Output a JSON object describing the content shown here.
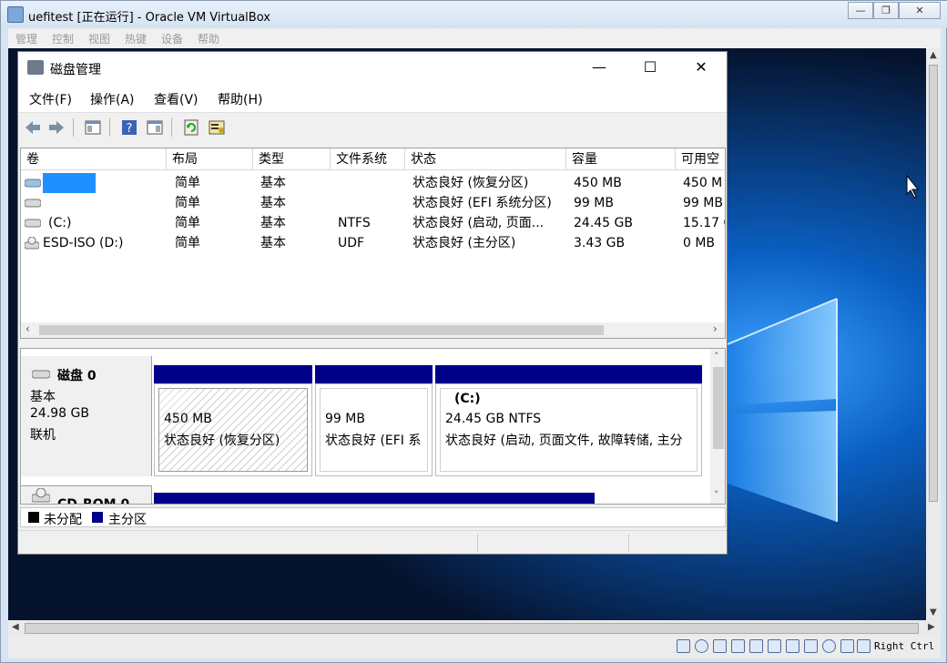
{
  "vbox": {
    "title": "uefitest [正在运行] - Oracle VM VirtualBox",
    "menu": [
      "管理",
      "控制",
      "视图",
      "热键",
      "设备",
      "帮助"
    ],
    "status_key": "Right Ctrl"
  },
  "dm": {
    "title": "磁盘管理",
    "window_buttons": {
      "minimize": "—",
      "maximize": "☐",
      "close": "✕"
    },
    "menu": [
      "文件(F)",
      "操作(A)",
      "查看(V)",
      "帮助(H)"
    ],
    "columns": [
      "卷",
      "布局",
      "类型",
      "文件系统",
      "状态",
      "容量",
      "可用空"
    ],
    "volumes": [
      {
        "name": "",
        "layout": "简单",
        "type": "基本",
        "fs": "",
        "status": "状态良好 (恢复分区)",
        "capacity": "450 MB",
        "free": "450 M"
      },
      {
        "name": "",
        "layout": "简单",
        "type": "基本",
        "fs": "",
        "status": "状态良好 (EFI 系统分区)",
        "capacity": "99 MB",
        "free": "99 MB"
      },
      {
        "name": "(C:)",
        "layout": "简单",
        "type": "基本",
        "fs": "NTFS",
        "status": "状态良好 (启动, 页面...",
        "capacity": "24.45 GB",
        "free": "15.17 G"
      },
      {
        "name": "ESD-ISO (D:)",
        "layout": "简单",
        "type": "基本",
        "fs": "UDF",
        "status": "状态良好 (主分区)",
        "capacity": "3.43 GB",
        "free": "0 MB"
      }
    ],
    "disk0": {
      "name": "磁盘 0",
      "kind": "基本",
      "size": "24.98 GB",
      "state": "联机",
      "partitions": [
        {
          "label": "",
          "size": "450 MB",
          "status": "状态良好 (恢复分区)"
        },
        {
          "label": "",
          "size": "99 MB",
          "status": "状态良好 (EFI 系"
        },
        {
          "label": "(C:)",
          "size": "24.45 GB NTFS",
          "status": "状态良好 (启动, 页面文件, 故障转储, 主分"
        }
      ]
    },
    "cdrom": {
      "name": "CD-ROM 0"
    },
    "legend": [
      {
        "label": "未分配",
        "color": "#000000"
      },
      {
        "label": "主分区",
        "color": "#00008b"
      }
    ]
  }
}
